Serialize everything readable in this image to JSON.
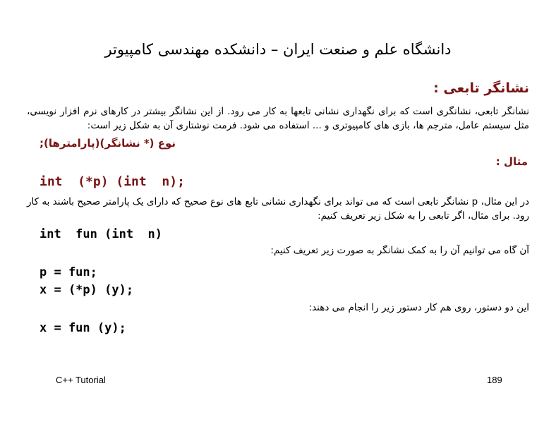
{
  "slide": {
    "title": "دانشگاه علم و صنعت ایران – دانشکده مهندسی کامپیوتر",
    "heading": "نشانگر تابعی :",
    "intro": "نشانگر تابعی، نشانگری است که برای نگهداری نشانی تابعها به کار می رود. از این نشانگر بیشتر در کارهای نرم افزار نویسی، مثل سیستم عامل، مترجم ها، بازی های کامپیوتری و ... استفاده می شود. فرمت نوشتاری آن به شکل زیر است:",
    "format": "نوع (* نشانگر)(پارامترها);",
    "example_label": "مثال :",
    "code_lines": [
      "int  (*p) (int  n);",
      "int  fun (int  n)",
      "p = fun;",
      "x = (*p) (y);",
      "x = fun (y);"
    ],
    "para2": "در این مثال، p نشانگر تابعی است که می تواند برای نگهداری نشانی تابع های نوع صحیح که دارای یک پارامتر صحیح باشند به کار رود. برای مثال، اگر تابعی را به شکل زیر تعریف کنیم:",
    "para3": "آن گاه می توانیم آن را به کمک نشانگر به صورت زیر تعریف کنیم:",
    "para4": "این دو دستور، روی هم کار دستور زیر را انجام می دهند:"
  },
  "footer": {
    "left": "C++ Tutorial",
    "page_number": "189"
  },
  "colors": {
    "accent": "#7a1414",
    "text": "#000000",
    "background": "#ffffff"
  }
}
